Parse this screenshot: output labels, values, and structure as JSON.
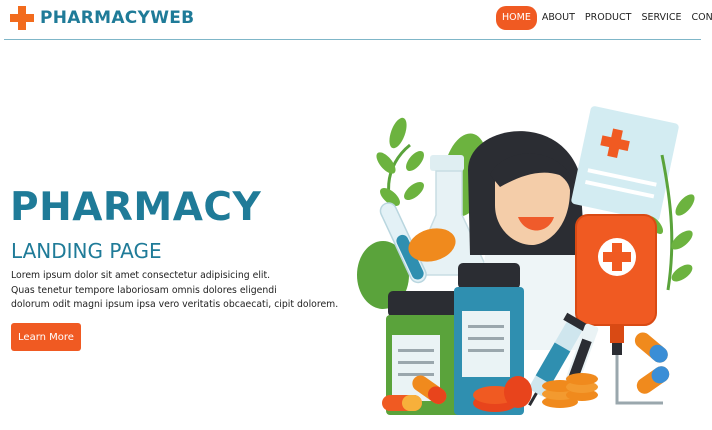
{
  "brand": {
    "name": "PHARMACYWEB",
    "logo_icon": "medical-cross-icon",
    "accent_color": "#f05a22",
    "brand_color": "#1f7b98"
  },
  "nav": {
    "items": [
      {
        "label": "HOME",
        "active": true
      },
      {
        "label": "ABOUT",
        "active": false
      },
      {
        "label": "PRODUCT",
        "active": false
      },
      {
        "label": "SERVICE",
        "active": false
      },
      {
        "label": "CONTACT",
        "active": false
      }
    ]
  },
  "hero": {
    "title": "PHARMACY",
    "subtitle": "LANDING PAGE",
    "description_lines": [
      "Lorem ipsum dolor sit amet consectetur adipisicing elit.",
      "Quas tenetur tempore laboriosam omnis dolores eligendi",
      "dolorum odit magni ipsum ipsa vero veritatis obcaecati, cipit dolorem."
    ],
    "cta_label": "Learn More"
  }
}
